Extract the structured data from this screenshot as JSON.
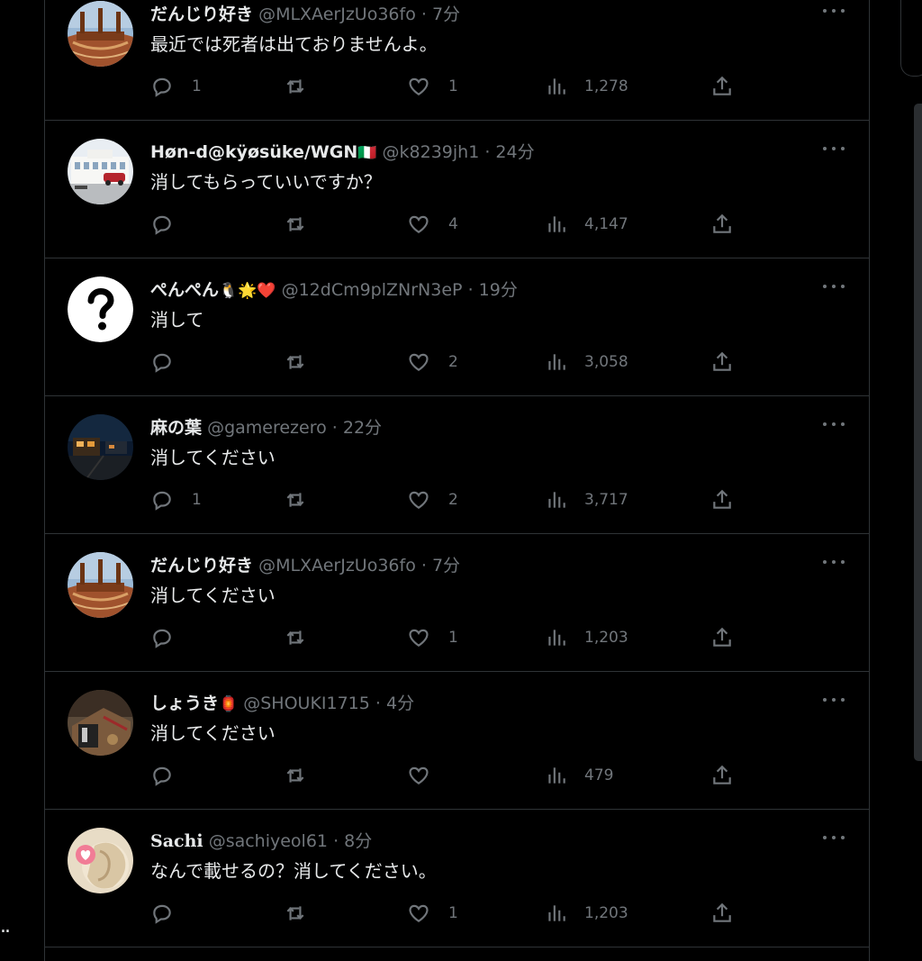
{
  "overflow_dots": "..",
  "icons": {
    "reply": "reply-icon",
    "retweet": "retweet-icon",
    "like": "heart-icon",
    "views": "views-icon",
    "share": "share-icon",
    "more": "more-icon"
  },
  "tweets": [
    {
      "name": "だんじり好き",
      "name_emoji": "",
      "handle": "@MLXAerJzUo36fo",
      "dot": "·",
      "time": "7分",
      "text": "最近では死者は出ておりませんよ。",
      "replies": "1",
      "retweets": "",
      "likes": "1",
      "views": "1,278",
      "avatar": "danjiri"
    },
    {
      "name": "Høn-d@kÿøsüke/WGN",
      "name_emoji": "🇮🇹",
      "handle": "@k8239jh1",
      "dot": "·",
      "time": "24分",
      "text": "消してもらっていいですか？",
      "replies": "",
      "retweets": "",
      "likes": "4",
      "views": "4,147",
      "avatar": "building"
    },
    {
      "name": "ぺんぺん",
      "name_emoji": "🐧🌟❤️",
      "handle": "@12dCm9plZNrN3eP",
      "dot": "·",
      "time": "19分",
      "text": "消して",
      "replies": "",
      "retweets": "",
      "likes": "2",
      "views": "3,058",
      "avatar": "question"
    },
    {
      "name": "麻の葉",
      "name_emoji": "",
      "handle": "@gamerezero",
      "dot": "·",
      "time": "22分",
      "text": "消してください",
      "replies": "1",
      "retweets": "",
      "likes": "2",
      "views": "3,717",
      "avatar": "night"
    },
    {
      "name": "だんじり好き",
      "name_emoji": "",
      "handle": "@MLXAerJzUo36fo",
      "dot": "·",
      "time": "7分",
      "text": "消してください",
      "replies": "",
      "retweets": "",
      "likes": "1",
      "views": "1,203",
      "avatar": "danjiri"
    },
    {
      "name": "しょうき",
      "name_emoji": "🏮",
      "handle": "@SHOUKI1715",
      "dot": "·",
      "time": "4分",
      "text": "消してください",
      "replies": "",
      "retweets": "",
      "likes": "",
      "views": "479",
      "avatar": "shouki"
    },
    {
      "name": "Sachi",
      "name_emoji": "",
      "handle": "@sachiyeol61",
      "dot": "·",
      "time": "8分",
      "text": "なんで載せるの？消してください。",
      "replies": "",
      "retweets": "",
      "likes": "1",
      "views": "1,203",
      "avatar": "sachi"
    }
  ]
}
